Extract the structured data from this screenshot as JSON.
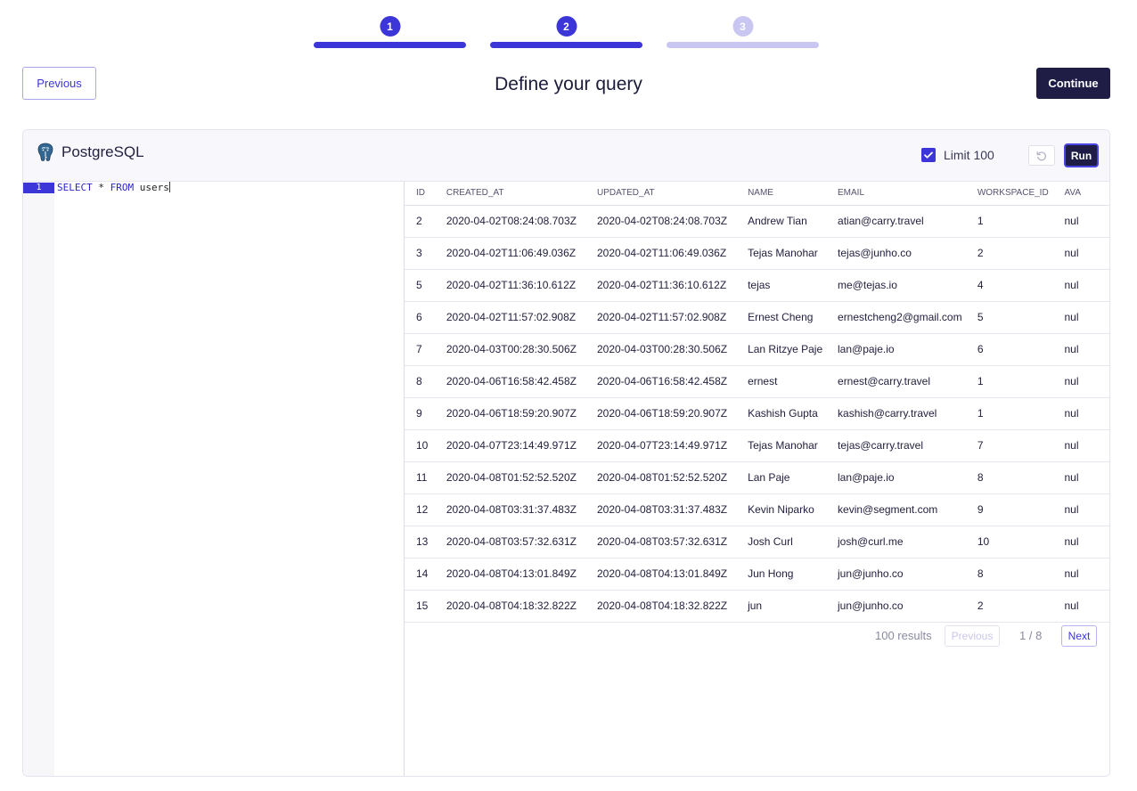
{
  "stepper": {
    "steps": [
      {
        "label": "1",
        "state": "complete"
      },
      {
        "label": "2",
        "state": "active"
      },
      {
        "label": "3",
        "state": "inactive"
      }
    ]
  },
  "header": {
    "previous_label": "Previous",
    "title": "Define your query",
    "continue_label": "Continue"
  },
  "panel": {
    "datasource_name": "PostgreSQL",
    "datasource_icon": "postgresql-elephant-icon",
    "limit_label": "Limit 100",
    "limit_checked": true,
    "run_label": "Run"
  },
  "editor": {
    "line_number": "1",
    "query_keyword_select": "SELECT",
    "query_star": " * ",
    "query_keyword_from": "FROM",
    "query_table": " users"
  },
  "results": {
    "columns": [
      "ID",
      "CREATED_AT",
      "UPDATED_AT",
      "NAME",
      "EMAIL",
      "WORKSPACE_ID",
      "AVA"
    ],
    "rows": [
      [
        "2",
        "2020-04-02T08:24:08.703Z",
        "2020-04-02T08:24:08.703Z",
        "Andrew Tian",
        "atian@carry.travel",
        "1",
        "nul"
      ],
      [
        "3",
        "2020-04-02T11:06:49.036Z",
        "2020-04-02T11:06:49.036Z",
        "Tejas Manohar",
        "tejas@junho.co",
        "2",
        "nul"
      ],
      [
        "5",
        "2020-04-02T11:36:10.612Z",
        "2020-04-02T11:36:10.612Z",
        "tejas",
        "me@tejas.io",
        "4",
        "nul"
      ],
      [
        "6",
        "2020-04-02T11:57:02.908Z",
        "2020-04-02T11:57:02.908Z",
        "Ernest Cheng",
        "ernestcheng2@gmail.com",
        "5",
        "nul"
      ],
      [
        "7",
        "2020-04-03T00:28:30.506Z",
        "2020-04-03T00:28:30.506Z",
        "Lan Ritzye Paje",
        "lan@paje.io",
        "6",
        "nul"
      ],
      [
        "8",
        "2020-04-06T16:58:42.458Z",
        "2020-04-06T16:58:42.458Z",
        "ernest",
        "ernest@carry.travel",
        "1",
        "nul"
      ],
      [
        "9",
        "2020-04-06T18:59:20.907Z",
        "2020-04-06T18:59:20.907Z",
        "Kashish Gupta",
        "kashish@carry.travel",
        "1",
        "nul"
      ],
      [
        "10",
        "2020-04-07T23:14:49.971Z",
        "2020-04-07T23:14:49.971Z",
        "Tejas Manohar",
        "tejas@carry.travel",
        "7",
        "nul"
      ],
      [
        "11",
        "2020-04-08T01:52:52.520Z",
        "2020-04-08T01:52:52.520Z",
        "Lan Paje",
        "lan@paje.io",
        "8",
        "nul"
      ],
      [
        "12",
        "2020-04-08T03:31:37.483Z",
        "2020-04-08T03:31:37.483Z",
        "Kevin Niparko",
        "kevin@segment.com",
        "9",
        "nul"
      ],
      [
        "13",
        "2020-04-08T03:57:32.631Z",
        "2020-04-08T03:57:32.631Z",
        "Josh Curl",
        "josh@curl.me",
        "10",
        "nul"
      ],
      [
        "14",
        "2020-04-08T04:13:01.849Z",
        "2020-04-08T04:13:01.849Z",
        "Jun Hong",
        "jun@junho.co",
        "8",
        "nul"
      ],
      [
        "15",
        "2020-04-08T04:18:32.822Z",
        "2020-04-08T04:18:32.822Z",
        "jun",
        "jun@junho.co",
        "2",
        "nul"
      ]
    ],
    "count_label": "100 results",
    "prev_label": "Previous",
    "page_info": "1 / 8",
    "next_label": "Next"
  },
  "colors": {
    "accent": "#3c35d8",
    "accent_light": "#c9c6f1",
    "dark_button": "#1f1d45"
  }
}
